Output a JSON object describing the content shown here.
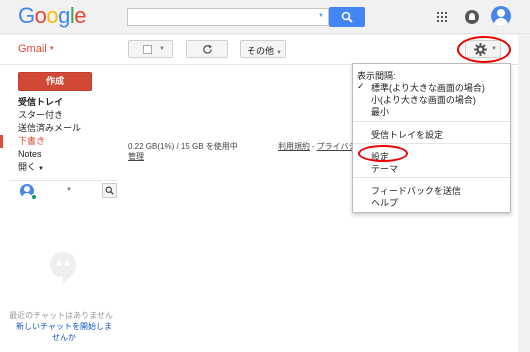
{
  "header": {
    "logo_letters": [
      "G",
      "o",
      "o",
      "g",
      "l",
      "e"
    ],
    "logo_colors": [
      "#4285f4",
      "#ea4335",
      "#fbbc05",
      "#4285f4",
      "#34a853",
      "#ea4335"
    ],
    "search": {
      "value": "",
      "placeholder": ""
    },
    "icons": [
      "apps-grid-icon",
      "notifications-icon",
      "account-avatar-icon"
    ]
  },
  "toolbar": {
    "gmail_label": "Gmail",
    "more_label": "その他"
  },
  "sidebar": {
    "compose_label": "作成",
    "items": [
      {
        "label": "受信トレイ",
        "style": "bold"
      },
      {
        "label": "スター付き",
        "style": "normal"
      },
      {
        "label": "送信済みメール",
        "style": "normal"
      },
      {
        "label": "下書き",
        "style": "draft"
      },
      {
        "label": "Notes",
        "style": "normal"
      },
      {
        "label": "開く",
        "style": "more"
      }
    ],
    "hangouts": {
      "no_chat_text": "最近のチャットはありません",
      "start_chat_text": "新しいチャットを開始しませんか"
    }
  },
  "main": {
    "storage_text": "0.22 GB(1%) / 15 GB を使用中",
    "manage_label": "管理",
    "terms_label": "利用規約",
    "terms_separator": "-",
    "privacy_label": "プライバシ"
  },
  "settings_menu": {
    "header": "表示間隔:",
    "density_options": [
      {
        "label": "標準(より大きな画面の場合)",
        "checked": true
      },
      {
        "label": "小(より大きな画面の場合)",
        "checked": false
      },
      {
        "label": "最小",
        "checked": false
      }
    ],
    "check_mark": "✓",
    "configure_inbox": "受信トレイを設定",
    "settings": "設定",
    "themes": "テーマ",
    "send_feedback": "フィードバックを送信",
    "help": "ヘルプ"
  },
  "colors": {
    "accent_red": "#dd4b39",
    "compose_red": "#d14836",
    "search_blue": "#4285f4",
    "link_blue": "#15c",
    "annotation_red": "#ee0000"
  }
}
